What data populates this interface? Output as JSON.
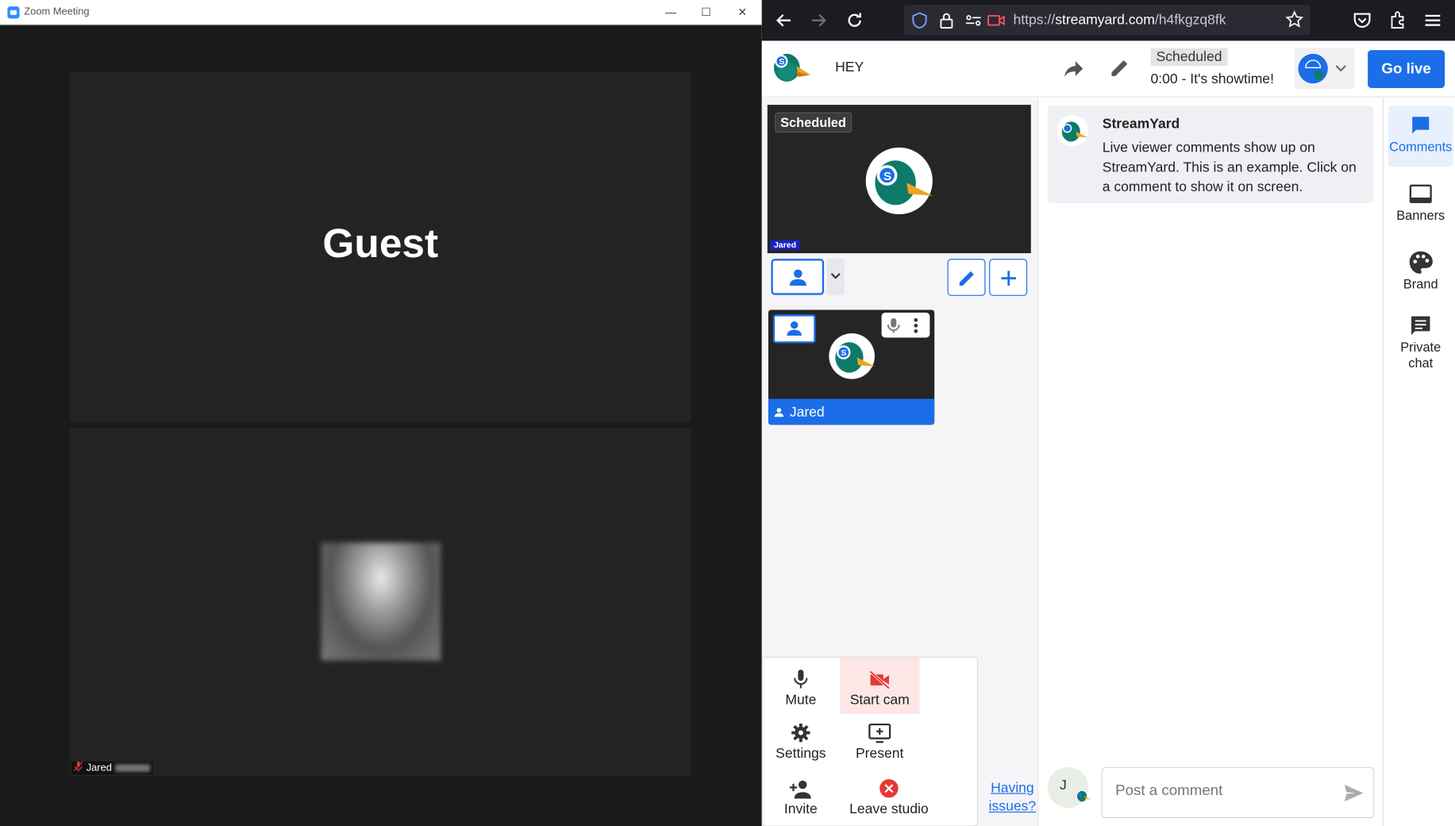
{
  "zoom": {
    "window_title": "Zoom Meeting",
    "guest_label": "Guest",
    "participant_name": "Jared"
  },
  "browser": {
    "url_scheme": "https://",
    "url_host": "streamyard.com",
    "url_path": "/h4fkgzq8fk"
  },
  "studio": {
    "broadcast_title": "HEY",
    "status_badge": "Scheduled",
    "showtime": "0:00 - It's showtime!",
    "go_live_label": "Go live",
    "accent": "#1b6ee8"
  },
  "preview": {
    "badge": "Scheduled",
    "name_tag": "Jared"
  },
  "guest_card": {
    "name": "Jared"
  },
  "controls": {
    "mute": "Mute",
    "start_cam": "Start cam",
    "settings": "Settings",
    "present": "Present",
    "invite": "Invite",
    "leave": "Leave studio",
    "help_link": "Having issues?"
  },
  "comments": {
    "items": [
      {
        "author": "StreamYard",
        "text": "Live viewer comments show up on StreamYard. This is an example. Click on a comment to show it on screen."
      }
    ],
    "input_placeholder": "Post a comment",
    "me_initial": "J"
  },
  "sidebar": {
    "items": [
      {
        "label": "Comments",
        "icon": "comment-icon",
        "active": true
      },
      {
        "label": "Banners",
        "icon": "banner-icon"
      },
      {
        "label": "Brand",
        "icon": "palette-icon"
      },
      {
        "label": "Private chat",
        "icon": "chat-icon"
      }
    ]
  }
}
